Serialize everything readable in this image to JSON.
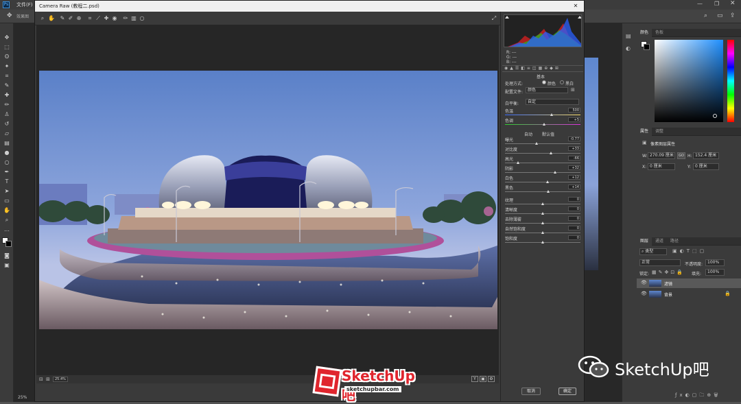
{
  "ps": {
    "menu_file": "文件(F)",
    "tab_label": "效果图",
    "zoom": "25%",
    "color_tabs": [
      "颜色",
      "色板"
    ],
    "props_tabs": [
      "属性",
      "调整"
    ],
    "props_title": "像素图层属性",
    "props_w_label": "W:",
    "props_w": "270.09 厘米",
    "props_h_label": "H:",
    "props_h": "152.4 厘米",
    "props_x_label": "X:",
    "props_x": "0 厘米",
    "props_y_label": "Y:",
    "props_y": "0 厘米",
    "link_label": "GO",
    "layers_tabs": [
      "图层",
      "通道",
      "路径"
    ],
    "layer_kind": "类型",
    "blend_mode": "正常",
    "opacity_label": "不透明度:",
    "opacity": "100%",
    "lock_label": "锁定:",
    "fill_label": "填充:",
    "fill": "100%",
    "layers": [
      {
        "name": "滤镜",
        "selected": true,
        "locked": false
      },
      {
        "name": "背景",
        "selected": false,
        "locked": true
      }
    ]
  },
  "cr": {
    "title": "Camera Raw (教程二.psd)",
    "zoom": "25.4%",
    "histogram_readouts": [
      "R: ---",
      "G: ---",
      "B: ---"
    ],
    "section_title": "基本",
    "treatment_label": "处理方式:",
    "treatment_color": "颜色",
    "treatment_bw": "黑白",
    "profile_label": "配置文件:",
    "profile_value": "颜色",
    "wb_label": "白平衡:",
    "wb_value": "自定",
    "sliders1": [
      {
        "label": "色温",
        "value": "500",
        "pos": 0.62,
        "track": "temp"
      },
      {
        "label": "色调",
        "value": "+5",
        "pos": 0.52,
        "track": "tint"
      }
    ],
    "auto_label": "自动",
    "default_label": "默认值",
    "sliders2": [
      {
        "label": "曝光",
        "value": "-0.77",
        "pos": 0.42
      },
      {
        "label": "对比度",
        "value": "+33",
        "pos": 0.61
      },
      {
        "label": "高光",
        "value": "-66",
        "pos": 0.17
      },
      {
        "label": "阴影",
        "value": "+32",
        "pos": 0.66
      },
      {
        "label": "白色",
        "value": "+12",
        "pos": 0.56
      },
      {
        "label": "黑色",
        "value": "+14",
        "pos": 0.57
      }
    ],
    "sliders3": [
      {
        "label": "纹理",
        "value": "0",
        "pos": 0.5
      },
      {
        "label": "清晰度",
        "value": "0",
        "pos": 0.5
      },
      {
        "label": "去除薄雾",
        "value": "0",
        "pos": 0.5
      },
      {
        "label": "自然饱和度",
        "value": "0",
        "pos": 0.5
      },
      {
        "label": "饱和度",
        "value": "0",
        "pos": 0.5
      }
    ],
    "cancel": "取消",
    "ok": "确定"
  },
  "watermark": {
    "brand": "SketchUp吧",
    "url": "sketchupbar.com",
    "wechat_text": "SketchUp吧"
  },
  "colors": {
    "accent": "#5aa0ff",
    "layer_selected": "#595959",
    "watermark_red": "#e0252d"
  }
}
